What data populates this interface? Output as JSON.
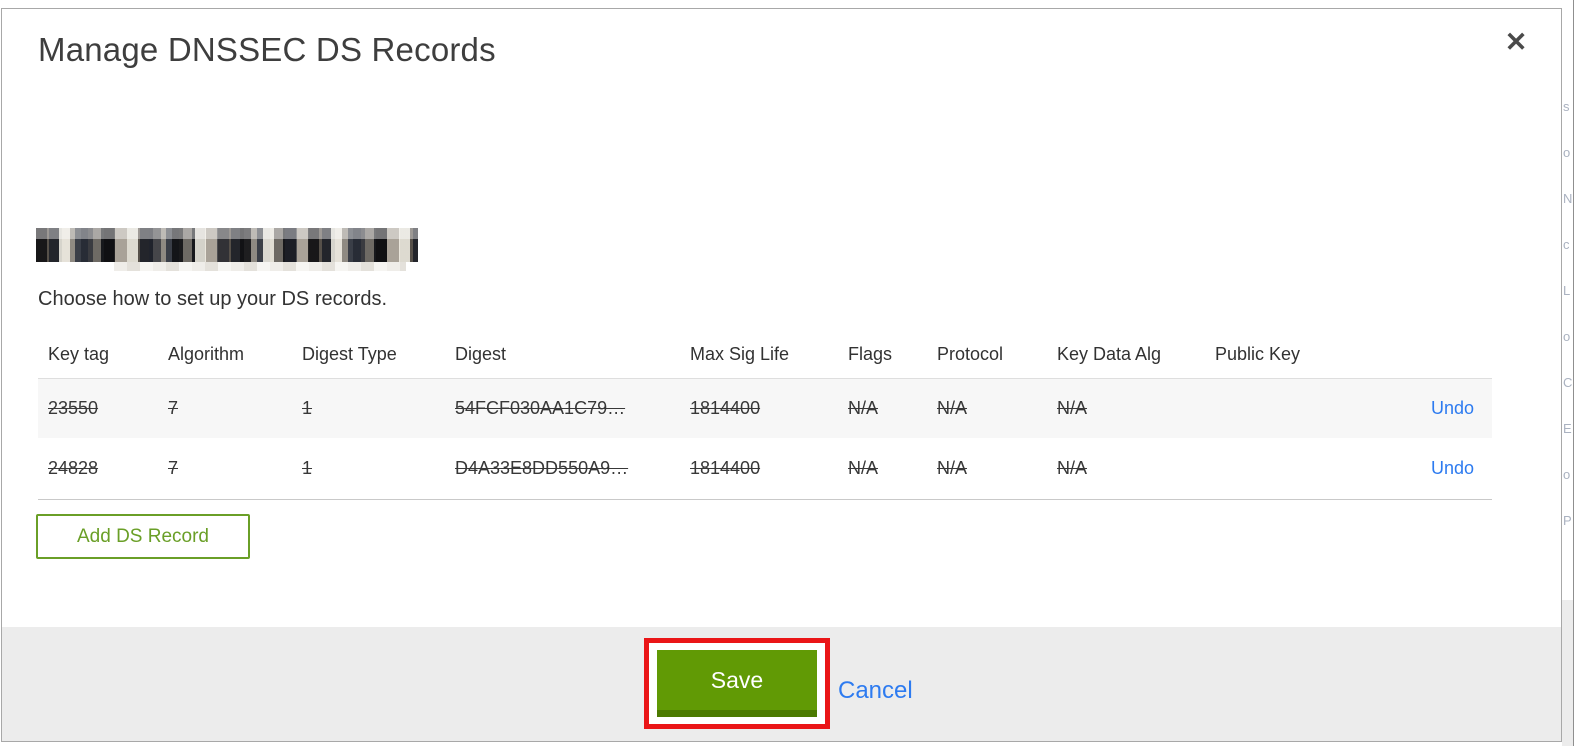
{
  "modal": {
    "title": "Manage DNSSEC DS Records",
    "close_icon": "✕",
    "lead": "Choose how to set up your DS records.",
    "table": {
      "headers": [
        "Key tag",
        "Algorithm",
        "Digest Type",
        "Digest",
        "Max Sig Life",
        "Flags",
        "Protocol",
        "Key Data Alg",
        "Public Key"
      ],
      "rows": [
        {
          "key_tag": "23550",
          "algorithm": "7",
          "digest_type": "1",
          "digest": "54FCF030AA1C79…",
          "max_sig_life": "1814400",
          "flags": "N/A",
          "protocol": "N/A",
          "key_data_alg": "N/A",
          "public_key": "",
          "action": "Undo"
        },
        {
          "key_tag": "24828",
          "algorithm": "7",
          "digest_type": "1",
          "digest": "D4A33E8DD550A9…",
          "max_sig_life": "1814400",
          "flags": "N/A",
          "protocol": "N/A",
          "key_data_alg": "N/A",
          "public_key": "",
          "action": "Undo"
        }
      ]
    },
    "add_button_label": "Add DS Record",
    "footer": {
      "save_label": "Save",
      "cancel_label": "Cancel"
    }
  },
  "colors": {
    "accent_green": "#6a9f27",
    "save_green": "#619a05",
    "save_green_dark": "#4b7a00",
    "highlight_red": "#ea1517",
    "link_blue": "#2d7bf0",
    "footer_gray": "#ececec",
    "row_alt_gray": "#f7f7f7"
  },
  "background_edge": {
    "fragments": "s\no\nN\nc\nL\no\nC\nE\no\nP"
  }
}
